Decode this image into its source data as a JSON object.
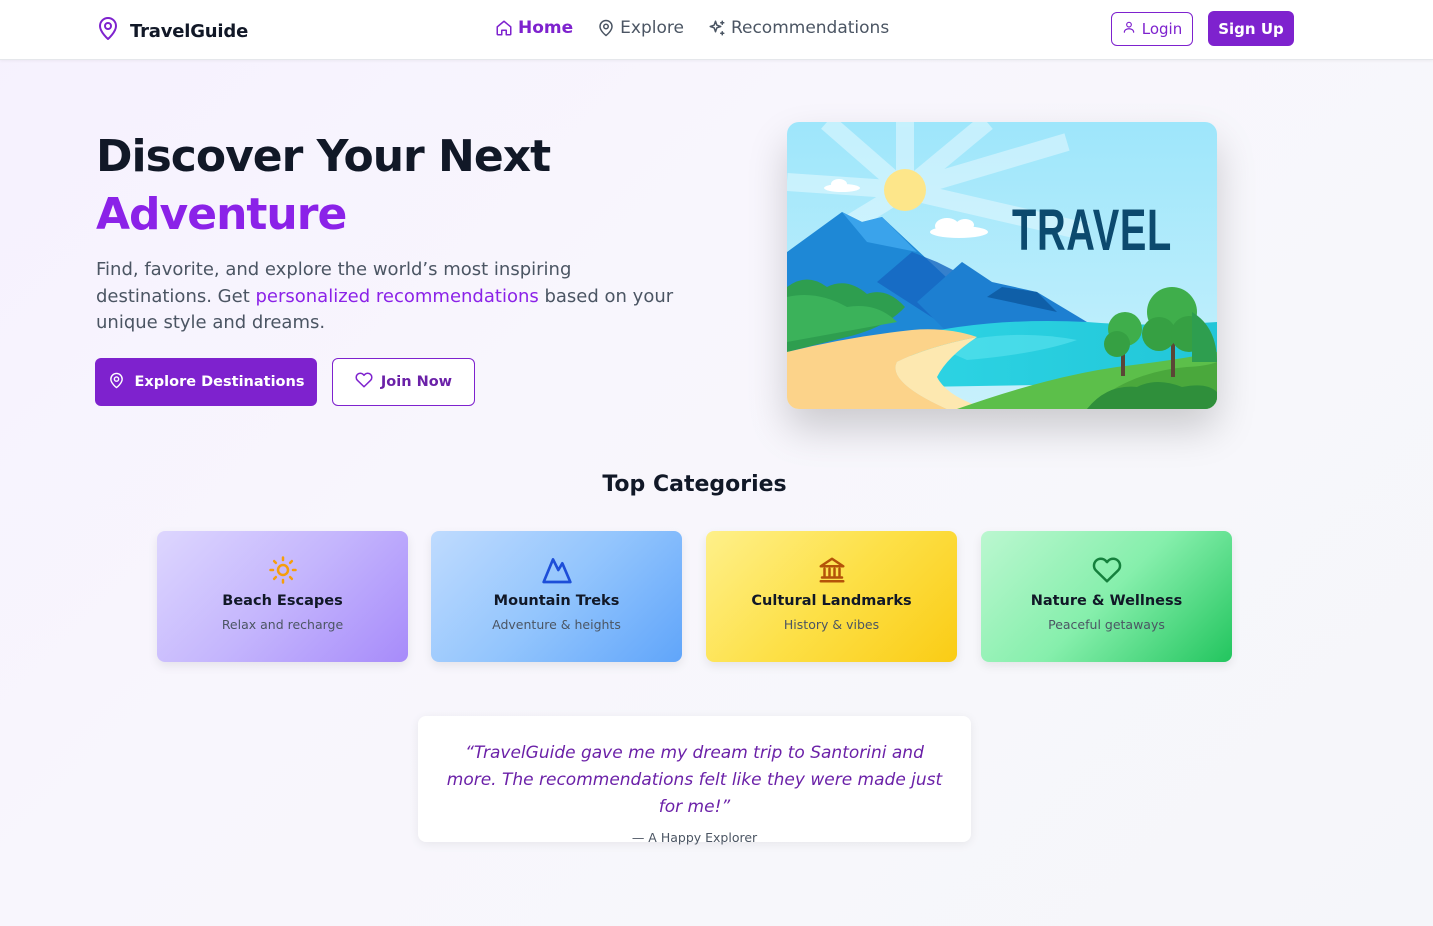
{
  "nav": {
    "brand": "TravelGuide",
    "links": [
      {
        "label": "Home",
        "icon": "home-icon",
        "active": true
      },
      {
        "label": "Explore",
        "icon": "map-pin-icon",
        "active": false
      },
      {
        "label": "Recommendations",
        "icon": "sparkles-icon",
        "active": false
      }
    ],
    "login_label": "Login",
    "signup_label": "Sign Up"
  },
  "hero": {
    "title_line1": "Discover Your Next",
    "title_line2": "Adventure",
    "desc_part1": "Find, favorite, and explore the world’s most inspiring destinations. Get ",
    "desc_highlight": "personalized recommendations",
    "desc_part2": " based on your unique style and dreams.",
    "explore_label": "Explore Destinations",
    "join_label": "Join Now",
    "image_text": "TRAVEL"
  },
  "categories": {
    "title": "Top Categories",
    "items": [
      {
        "name": "Beach Escapes",
        "sub": "Relax and recharge",
        "icon": "sun-icon"
      },
      {
        "name": "Mountain Treks",
        "sub": "Adventure & heights",
        "icon": "mountain-icon"
      },
      {
        "name": "Cultural Landmarks",
        "sub": "History & vibes",
        "icon": "landmark-icon"
      },
      {
        "name": "Nature & Wellness",
        "sub": "Peaceful getaways",
        "icon": "heart-icon"
      }
    ]
  },
  "testimonial": {
    "quote": "“TravelGuide gave me my dream trip to Santorini and more. The recommendations felt like they were made just for me!”",
    "author": "— A Happy Explorer"
  },
  "colors": {
    "accent": "#7e22ce",
    "accent_text": "#8b22e8"
  }
}
